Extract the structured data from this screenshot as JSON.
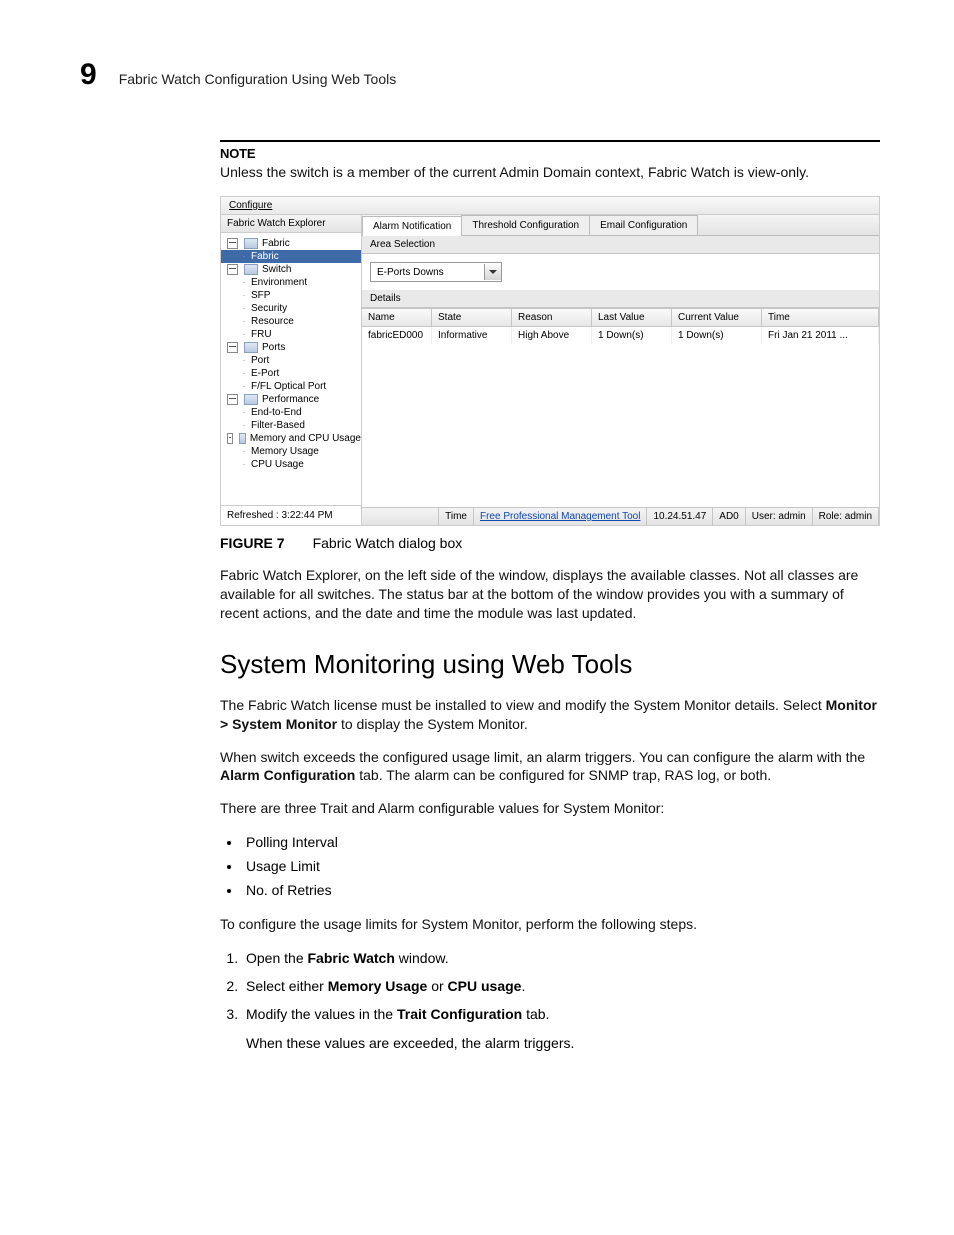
{
  "header": {
    "chapter_number": "9",
    "chapter_title": "Fabric Watch Configuration Using Web Tools"
  },
  "note": {
    "heading": "NOTE",
    "body": "Unless the switch is a member of the current Admin Domain context, Fabric Watch is view-only."
  },
  "figure": {
    "menu": "Configure",
    "tree_title": "Fabric Watch Explorer",
    "tree": [
      {
        "label": "Fabric",
        "lvl": 1,
        "folder": true
      },
      {
        "label": "Fabric",
        "lvl": 2,
        "sel": true
      },
      {
        "label": "Switch",
        "lvl": 1,
        "folder": true
      },
      {
        "label": "Environment",
        "lvl": 2
      },
      {
        "label": "SFP",
        "lvl": 2
      },
      {
        "label": "Security",
        "lvl": 2
      },
      {
        "label": "Resource",
        "lvl": 2
      },
      {
        "label": "FRU",
        "lvl": 2
      },
      {
        "label": "Ports",
        "lvl": 1,
        "folder": true
      },
      {
        "label": "Port",
        "lvl": 2
      },
      {
        "label": "E-Port",
        "lvl": 2
      },
      {
        "label": "F/FL Optical Port",
        "lvl": 2
      },
      {
        "label": "Performance",
        "lvl": 1,
        "folder": true
      },
      {
        "label": "End-to-End",
        "lvl": 2
      },
      {
        "label": "Filter-Based",
        "lvl": 2
      },
      {
        "label": "Memory and CPU Usage",
        "lvl": 1,
        "folder": true
      },
      {
        "label": "Memory Usage",
        "lvl": 2
      },
      {
        "label": "CPU Usage",
        "lvl": 2
      }
    ],
    "refreshed": "Refreshed : 3:22:44 PM",
    "tabs": [
      "Alarm Notification",
      "Threshold Configuration",
      "Email Configuration"
    ],
    "active_tab": 0,
    "area_label": "Area Selection",
    "area_value": "E-Ports Downs",
    "details_label": "Details",
    "grid_cols": [
      "Name",
      "State",
      "Reason",
      "Last Value",
      "Current Value",
      "Time"
    ],
    "grid_rows": [
      [
        "fabricED000",
        "Informative",
        "High Above",
        "1 Down(s)",
        "1 Down(s)",
        "Fri Jan 21 2011 ..."
      ]
    ],
    "status": {
      "time_lbl": "Time",
      "link": "Free Professional Management Tool",
      "ip": "10.24.51.47",
      "ad": "AD0",
      "user": "User: admin",
      "role": "Role: admin"
    },
    "caption_label": "FIGURE 7",
    "caption_text": "Fabric Watch dialog box"
  },
  "after_fig_para": "Fabric Watch Explorer, on the left side of the window, displays the available classes. Not all classes are available for all switches. The status bar at the bottom of the window provides you with a summary of recent actions, and the date and time the module was last updated.",
  "h2": "System Monitoring using Web Tools",
  "sm": {
    "p1_a": "The Fabric Watch license must be installed to view and modify the System Monitor details. Select ",
    "p1_b": "Monitor > System Monitor",
    "p1_c": " to display the System Monitor.",
    "p2_a": "When switch exceeds the configured usage limit, an alarm triggers. You can configure the alarm with the ",
    "p2_b": "Alarm Configuration",
    "p2_c": " tab. The alarm can be configured for SNMP trap, RAS log, or both.",
    "p3": "There are three Trait and Alarm configurable values for System Monitor:",
    "bullets": [
      "Polling Interval",
      "Usage Limit",
      "No. of Retries"
    ],
    "p4": "To configure the usage limits for System Monitor, perform the following steps.",
    "steps": [
      {
        "pre": "Open the ",
        "b": "Fabric Watch",
        "post": " window."
      },
      {
        "pre": "Select either ",
        "b": "Memory Usage",
        "mid": " or ",
        "b2": "CPU usage",
        "post": "."
      },
      {
        "pre": "Modify the values in the ",
        "b": "Trait Configuration",
        "post": " tab.",
        "sub": "When these values are exceeded, the alarm triggers."
      }
    ]
  }
}
